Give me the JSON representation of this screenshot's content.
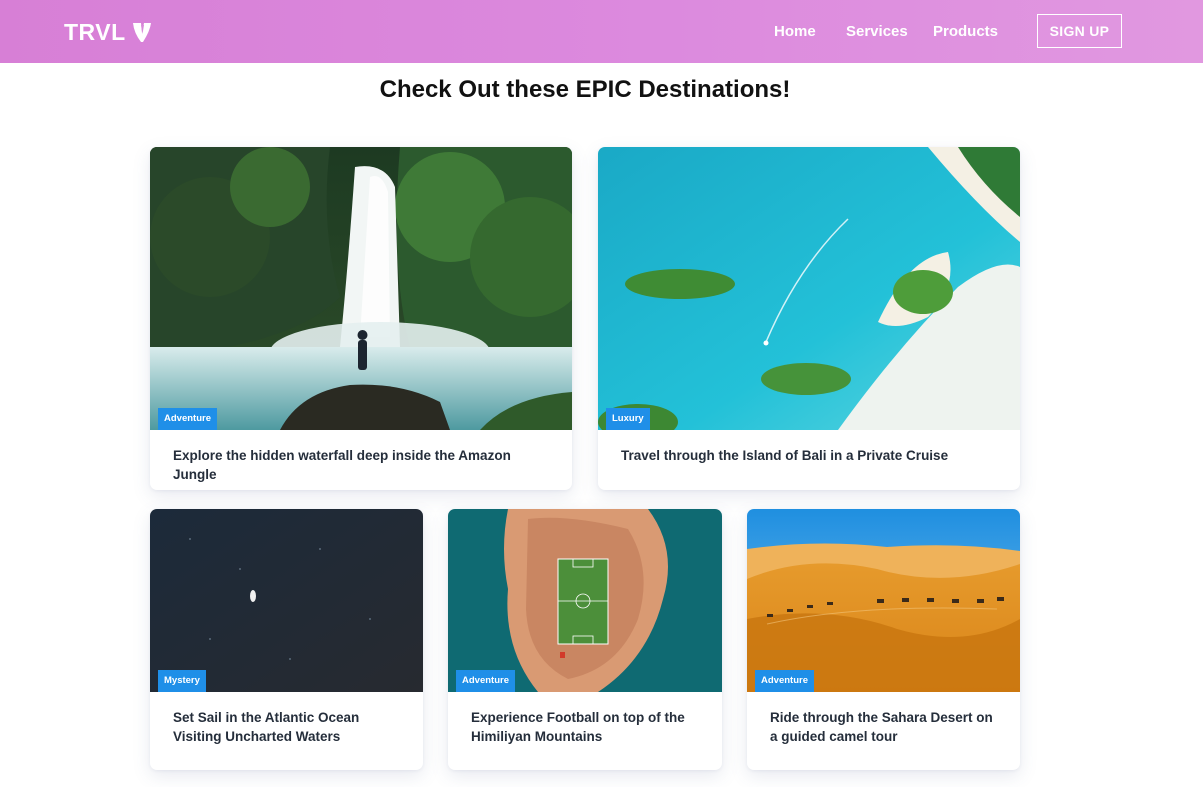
{
  "brand": {
    "name": "TRVL"
  },
  "nav": {
    "links": [
      "Home",
      "Services",
      "Products"
    ],
    "signup_label": "SIGN UP"
  },
  "page": {
    "title": "Check Out these EPIC Destinations!"
  },
  "cards": [
    {
      "badge": "Adventure",
      "title": "Explore the hidden waterfall deep inside the Amazon Jungle",
      "image": "waterfall-jungle-photo"
    },
    {
      "badge": "Luxury",
      "title": "Travel through the Island of Bali in a Private Cruise",
      "image": "bali-islands-aerial-photo"
    },
    {
      "badge": "Mystery",
      "title": "Set Sail in the Atlantic Ocean Visiting Uncharted Waters",
      "image": "dark-ocean-boat-photo"
    },
    {
      "badge": "Adventure",
      "title": "Experience Football on top of the Himiliyan Mountains",
      "image": "football-field-on-rock-photo"
    },
    {
      "badge": "Adventure",
      "title": "Ride through the Sahara Desert on a guided camel tour",
      "image": "sahara-camel-caravan-photo"
    }
  ],
  "colors": {
    "navbar_gradient_start": "#d77fd6",
    "navbar_gradient_end": "#e198e0",
    "badge": "#1f8fe8",
    "heading": "#111111",
    "card_title": "#252e3b"
  }
}
